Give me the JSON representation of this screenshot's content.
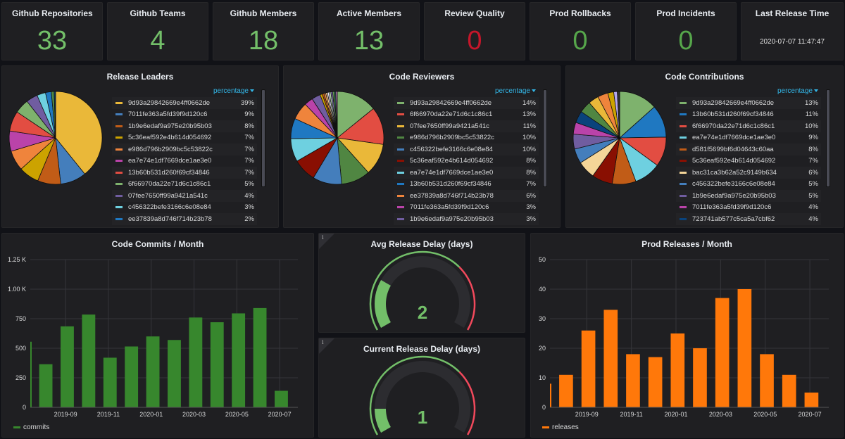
{
  "stats": [
    {
      "title": "Github Repositories",
      "value": "33",
      "color": "#73bf69"
    },
    {
      "title": "Github Teams",
      "value": "4",
      "color": "#73bf69"
    },
    {
      "title": "Github Members",
      "value": "18",
      "color": "#73bf69"
    },
    {
      "title": "Active Members",
      "value": "13",
      "color": "#73bf69"
    },
    {
      "title": "Review Quality",
      "value": "0",
      "color": "#c4162a"
    },
    {
      "title": "Prod Rollbacks",
      "value": "0",
      "color": "#56a64b"
    },
    {
      "title": "Prod Incidents",
      "value": "0",
      "color": "#56a64b"
    },
    {
      "title": "Last Release Time",
      "value": "2020-07-07 11:47:47",
      "color": "#e0e0e0"
    }
  ],
  "pies": [
    {
      "title": "Release Leaders",
      "legend_header": "percentage",
      "items": [
        {
          "label": "9d93a29842669e4ff0662de",
          "value": "39%",
          "pct": 39,
          "color": "#eab839"
        },
        {
          "label": "7011fe363a5fd39f9d120c6",
          "value": "9%",
          "pct": 9,
          "color": "#447ebc"
        },
        {
          "label": "1b9e6edaf9a975e20b95b03",
          "value": "8%",
          "pct": 8,
          "color": "#c15c17"
        },
        {
          "label": "5c36eaf592e4b614d054692",
          "value": "7%",
          "pct": 7,
          "color": "#cca300"
        },
        {
          "label": "e986d796b2909bc5c53822c",
          "value": "7%",
          "pct": 7,
          "color": "#ef843c"
        },
        {
          "label": "ea7e74e1df7669dce1ae3e0",
          "value": "7%",
          "pct": 7,
          "color": "#ba43a9"
        },
        {
          "label": "13b60b531d260f69cf34846",
          "value": "7%",
          "pct": 7,
          "color": "#e24d42"
        },
        {
          "label": "6f66970da22e71d6c1c86c1",
          "value": "5%",
          "pct": 5,
          "color": "#7eb26d"
        },
        {
          "label": "07fee7650ff99a9421a541c",
          "value": "4%",
          "pct": 4,
          "color": "#705da0"
        },
        {
          "label": "c456322befe3166c6e08e84",
          "value": "3%",
          "pct": 3,
          "color": "#6ed0e0"
        },
        {
          "label": "ee37839a8d746f714b23b78",
          "value": "2%",
          "pct": 2,
          "color": "#1f78c1"
        }
      ],
      "hidden_slices": [
        {
          "pct": 1,
          "color": "#508642"
        },
        {
          "pct": 0.5,
          "color": "#0a437c"
        }
      ]
    },
    {
      "title": "Code Reviewers",
      "legend_header": "percentage",
      "items": [
        {
          "label": "9d93a29842669e4ff0662de",
          "value": "14%",
          "pct": 14,
          "color": "#7eb26d"
        },
        {
          "label": "6f66970da22e71d6c1c86c1",
          "value": "13%",
          "pct": 13,
          "color": "#e24d42"
        },
        {
          "label": "07fee7650ff99a9421a541c",
          "value": "11%",
          "pct": 11,
          "color": "#eab839"
        },
        {
          "label": "e986d796b2909bc5c53822c",
          "value": "10%",
          "pct": 10,
          "color": "#508642"
        },
        {
          "label": "c456322befe3166c6e08e84",
          "value": "10%",
          "pct": 10,
          "color": "#447ebc"
        },
        {
          "label": "5c36eaf592e4b614d054692",
          "value": "8%",
          "pct": 8,
          "color": "#890f02"
        },
        {
          "label": "ea7e74e1df7669dce1ae3e0",
          "value": "8%",
          "pct": 8,
          "color": "#6ed0e0"
        },
        {
          "label": "13b60b531d260f69cf34846",
          "value": "7%",
          "pct": 7,
          "color": "#1f78c1"
        },
        {
          "label": "ee37839a8d746f714b23b78",
          "value": "6%",
          "pct": 6,
          "color": "#ef843c"
        },
        {
          "label": "7011fe363a5fd39f9d120c6",
          "value": "3%",
          "pct": 3,
          "color": "#ba43a9"
        },
        {
          "label": "1b9e6edaf9a975e20b95b03",
          "value": "3%",
          "pct": 3,
          "color": "#705da0"
        }
      ],
      "hidden_slices": [
        {
          "pct": 0.8,
          "color": "#cca300"
        },
        {
          "pct": 0.6,
          "color": "#c15c17"
        },
        {
          "pct": 0.6,
          "color": "#f9934e"
        },
        {
          "pct": 0.6,
          "color": "#f4d598"
        },
        {
          "pct": 0.6,
          "color": "#dedaf7"
        },
        {
          "pct": 0.6,
          "color": "#b7dbab"
        },
        {
          "pct": 0.6,
          "color": "#806eb7"
        },
        {
          "pct": 0.6,
          "color": "#629e51"
        },
        {
          "pct": 0.5,
          "color": "#2f575e"
        },
        {
          "pct": 0.5,
          "color": "#d683ce"
        }
      ]
    },
    {
      "title": "Code Contributions",
      "legend_header": "percentage",
      "items": [
        {
          "label": "9d93a29842669e4ff0662de",
          "value": "13%",
          "pct": 13,
          "color": "#7eb26d"
        },
        {
          "label": "13b60b531d260f69cf34846",
          "value": "11%",
          "pct": 11,
          "color": "#1f78c1"
        },
        {
          "label": "6f66970da22e71d6c1c86c1",
          "value": "10%",
          "pct": 10,
          "color": "#e24d42"
        },
        {
          "label": "ea7e74e1df7669dce1ae3e0",
          "value": "9%",
          "pct": 9,
          "color": "#6ed0e0"
        },
        {
          "label": "d581f5699bf6d04643c60aa",
          "value": "8%",
          "pct": 8,
          "color": "#c15c17"
        },
        {
          "label": "5c36eaf592e4b614d054692",
          "value": "7%",
          "pct": 7,
          "color": "#890f02"
        },
        {
          "label": "bac31ca3b62a52c9149b634",
          "value": "6%",
          "pct": 6,
          "color": "#f4d598"
        },
        {
          "label": "c456322befe3166c6e08e84",
          "value": "5%",
          "pct": 5,
          "color": "#447ebc"
        },
        {
          "label": "1b9e6edaf9a975e20b95b03",
          "value": "5%",
          "pct": 5,
          "color": "#705da0"
        },
        {
          "label": "7011fe363a5fd39f9d120c6",
          "value": "4%",
          "pct": 4,
          "color": "#ba43a9"
        },
        {
          "label": "723741ab577c5ca5a7cbf62",
          "value": "4%",
          "pct": 4,
          "color": "#0a437c"
        }
      ],
      "hidden_slices": [
        {
          "pct": 4,
          "color": "#508642"
        },
        {
          "pct": 3.5,
          "color": "#eab839"
        },
        {
          "pct": 3.5,
          "color": "#ef843c"
        },
        {
          "pct": 2,
          "color": "#cca300"
        },
        {
          "pct": 1.2,
          "color": "#b4a7f0"
        },
        {
          "pct": 0.8,
          "color": "#2f2f2f"
        }
      ]
    }
  ],
  "gauges": [
    {
      "title": "Avg Release Delay (days)",
      "value": 2,
      "display": "2",
      "min": 0,
      "max": 8,
      "threshold": 5.5,
      "ok_color": "#73bf69",
      "bad_color": "#f2495c"
    },
    {
      "title": "Current Release Delay (days)",
      "value": 1,
      "display": "1",
      "min": 0,
      "max": 8,
      "threshold": 5.5,
      "ok_color": "#73bf69",
      "bad_color": "#f2495c"
    }
  ],
  "info_icon": "i",
  "chart_data": [
    {
      "type": "bar",
      "title": "Code Commits / Month",
      "categories": [
        "2019-07",
        "2019-08",
        "2019-09",
        "2019-10",
        "2019-11",
        "2019-12",
        "2020-01",
        "2020-02",
        "2020-03",
        "2020-04",
        "2020-05",
        "2020-06",
        "2020-07"
      ],
      "series": [
        {
          "name": "commits",
          "color": "#37872d",
          "values": [
            555,
            365,
            685,
            785,
            420,
            515,
            600,
            570,
            760,
            720,
            795,
            840,
            140
          ]
        }
      ],
      "yticks": [
        "0",
        "250",
        "500",
        "750",
        "1.00 K",
        "1.25 K"
      ],
      "ytick_values": [
        0,
        250,
        500,
        750,
        1000,
        1250
      ],
      "xticks": [
        "2019-09",
        "2019-11",
        "2020-01",
        "2020-03",
        "2020-05",
        "2020-07"
      ],
      "ylim": [
        0,
        1250
      ],
      "grid": true,
      "legend": "bottom-left"
    },
    {
      "type": "bar",
      "title": "Prod Releases / Month",
      "categories": [
        "2019-07",
        "2019-08",
        "2019-09",
        "2019-10",
        "2019-11",
        "2019-12",
        "2020-01",
        "2020-02",
        "2020-03",
        "2020-04",
        "2020-05",
        "2020-06",
        "2020-07"
      ],
      "series": [
        {
          "name": "releases",
          "color": "#ff780a",
          "values": [
            8,
            11,
            26,
            33,
            18,
            17,
            25,
            20,
            37,
            40,
            18,
            11,
            5
          ]
        }
      ],
      "yticks": [
        "0",
        "10",
        "20",
        "30",
        "40",
        "50"
      ],
      "ytick_values": [
        0,
        10,
        20,
        30,
        40,
        50
      ],
      "xticks": [
        "2019-09",
        "2019-11",
        "2020-01",
        "2020-03",
        "2020-05",
        "2020-07"
      ],
      "ylim": [
        0,
        50
      ],
      "grid": true,
      "legend": "bottom-left"
    }
  ]
}
